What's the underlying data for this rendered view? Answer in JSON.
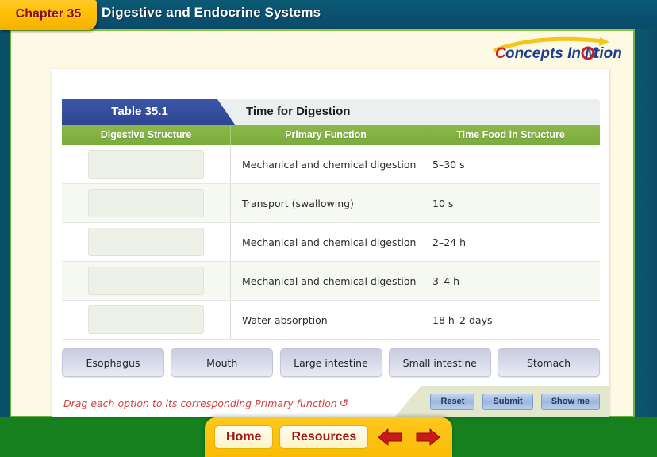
{
  "header": {
    "chapter_label": "Chapter 35",
    "title": "Digestive and Endocrine Systems",
    "logo_text": "Concepts In Motion",
    "logo_parts": {
      "c": "C",
      "mid": "oncepts In M",
      "o": "O",
      "end": "tion"
    }
  },
  "table": {
    "tag": "Table 35.1",
    "heading": "Time for Digestion",
    "columns": [
      "Digestive Structure",
      "Primary Function",
      "Time Food in Structure"
    ],
    "rows": [
      {
        "structure": "",
        "function": "Mechanical and chemical digestion",
        "time": "5–30 s"
      },
      {
        "structure": "",
        "function": "Transport (swallowing)",
        "time": "10 s"
      },
      {
        "structure": "",
        "function": "Mechanical and chemical digestion",
        "time": "2–24 h"
      },
      {
        "structure": "",
        "function": "Mechanical and chemical digestion",
        "time": "3–4 h"
      },
      {
        "structure": "",
        "function": "Water absorption",
        "time": "18 h–2 days"
      }
    ]
  },
  "options": [
    {
      "label": "Esophagus"
    },
    {
      "label": "Mouth"
    },
    {
      "label": "Large intestine"
    },
    {
      "label": "Small intestine"
    },
    {
      "label": "Stomach"
    }
  ],
  "footer": {
    "instruction": "Drag each option to its corresponding Primary function",
    "loop_icon": "↺",
    "buttons": [
      {
        "label": "Reset"
      },
      {
        "label": "Submit"
      },
      {
        "label": "Show me"
      }
    ]
  },
  "nav": {
    "home": "Home",
    "resources": "Resources",
    "back_icon": "back-arrow-icon",
    "forward_icon": "forward-arrow-icon"
  },
  "colors": {
    "frame_green": "#15801d",
    "title_blue": "#0b5070",
    "chapter_yellow": "#ffc107",
    "table_tag_blue": "#2e4593",
    "col_head_green": "#7aac3c",
    "instruction_red": "#d2433f",
    "nav_yellow": "#f9bc06",
    "nav_text_red": "#a01414"
  }
}
